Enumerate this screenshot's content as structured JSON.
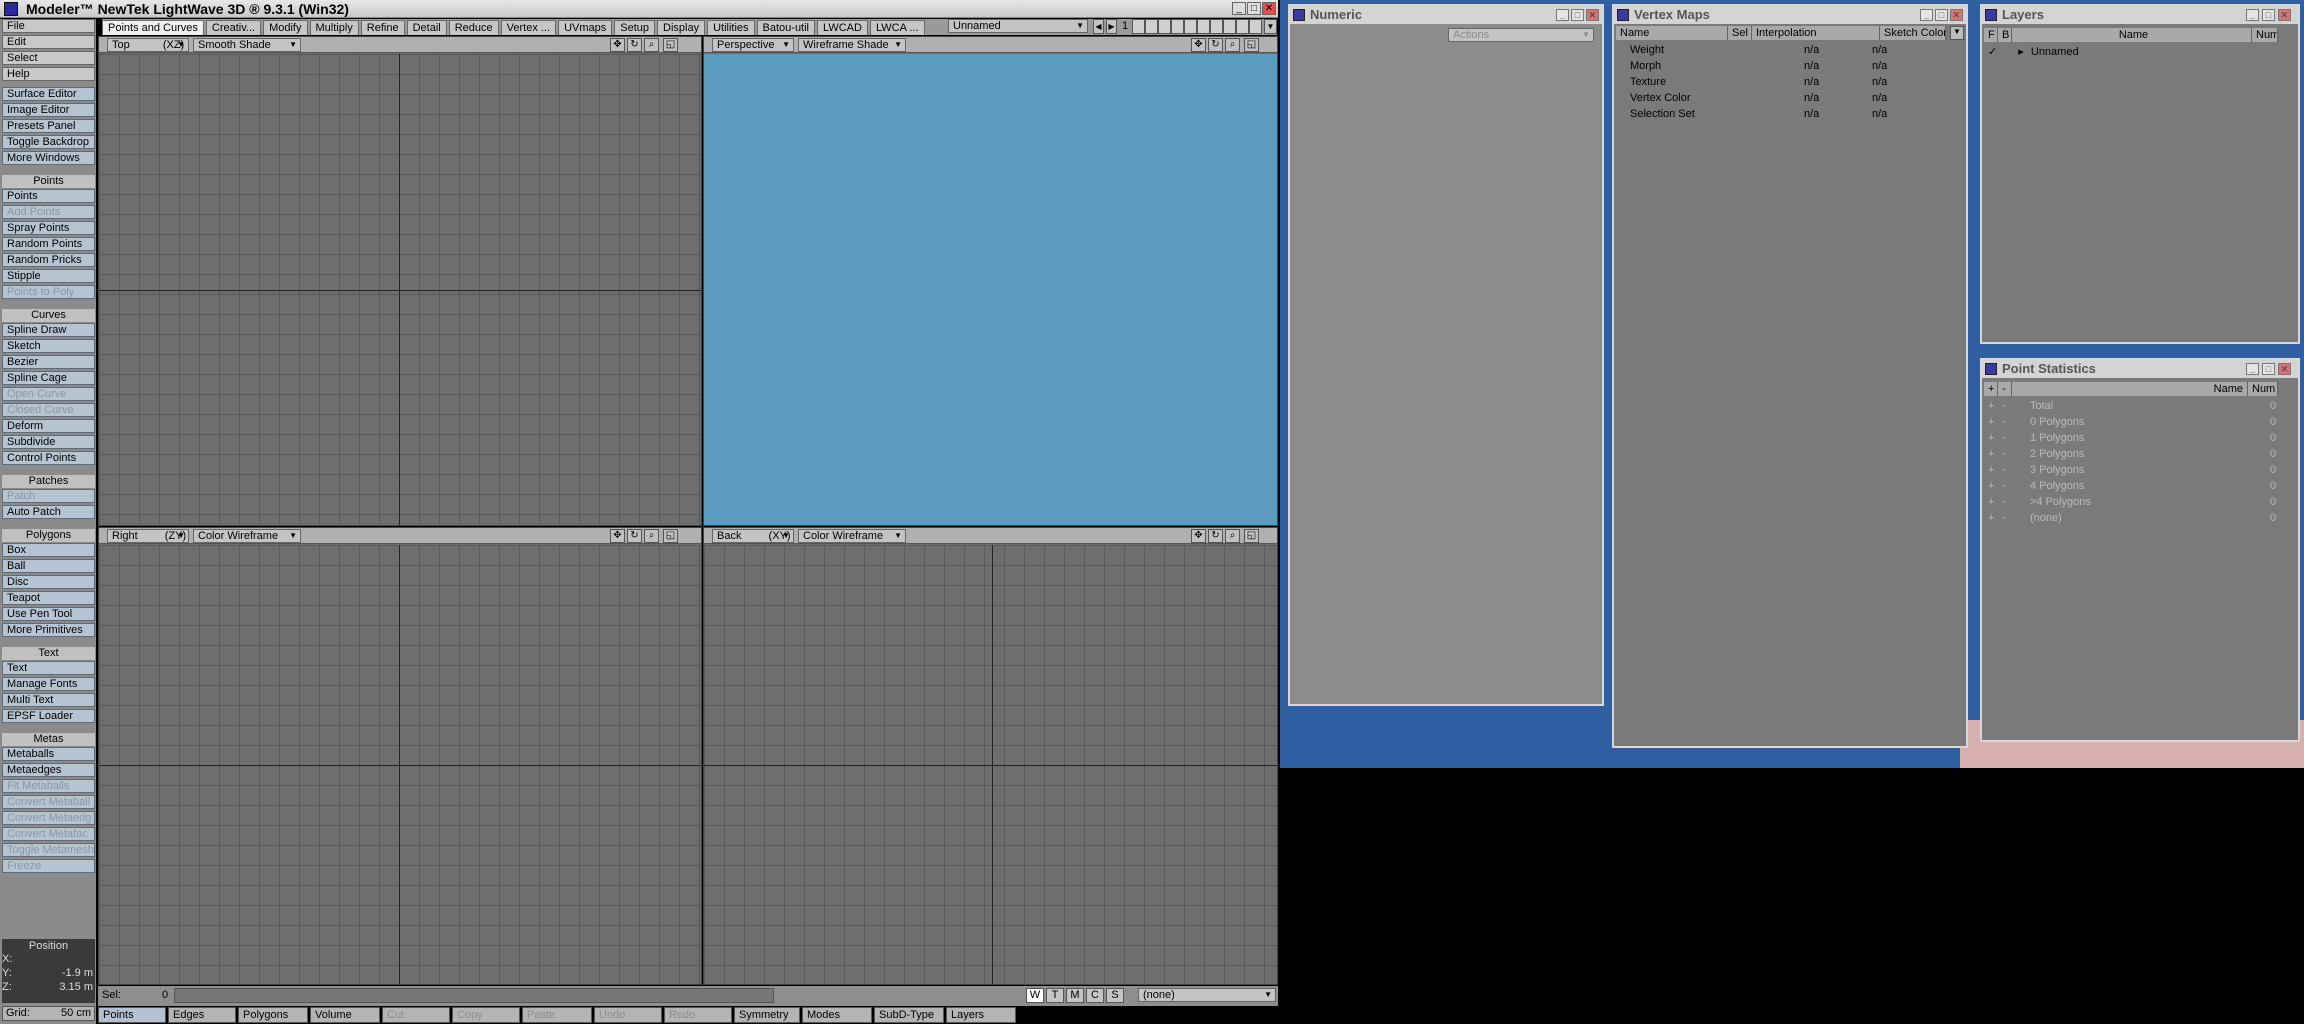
{
  "app": {
    "title": "Modeler™ NewTek LightWave 3D ® 9.3.1 (Win32)"
  },
  "tabs": [
    "Points and Curves",
    "Creativ...",
    "Modify",
    "Multiply",
    "Refine",
    "Reduce",
    "Detail",
    "Reduce",
    "Vertex ...",
    "UVmaps",
    "Setup",
    "Display",
    "Utilities",
    "Batou-util",
    "LWCAD",
    "LWCA ..."
  ],
  "object_dropdown": "Unnamed",
  "layer_num": "1",
  "sidebar": {
    "menus": [
      "File",
      "Edit",
      "Select",
      "Help"
    ],
    "windows": [
      "Surface Editor",
      "Image Editor",
      "Presets Panel",
      "Toggle Backdrop",
      "More Windows"
    ],
    "groups": [
      {
        "label": "Points",
        "items": [
          "Points",
          "Add Points",
          "Spray Points",
          "Random Points",
          "Random Pricks",
          "Stipple",
          "Points to Poly"
        ]
      },
      {
        "label": "Curves",
        "items": [
          "Spline Draw",
          "Sketch",
          "Bezier",
          "Spline Cage",
          "Open Curve",
          "Closed Curve",
          "Deform",
          "Subdivide",
          "Control Points"
        ]
      },
      {
        "label": "Patches",
        "items": [
          "Patch",
          "Auto Patch"
        ]
      },
      {
        "label": "Polygons",
        "items": [
          "Box",
          "Ball",
          "Disc",
          "Teapot",
          "Use Pen Tool",
          "More Primitives"
        ]
      },
      {
        "label": "Text",
        "items": [
          "Text",
          "Manage Fonts",
          "Multi Text",
          "EPSF Loader"
        ]
      },
      {
        "label": "Metas",
        "items": [
          "Metaballs",
          "Metaedges",
          "Fit Metaballs",
          "Convert Metaball",
          "Convert Metaedg",
          "Convert Metafac",
          "Toggle Metamesh",
          "Freeze"
        ]
      }
    ],
    "position": {
      "label": "Position",
      "x_label": "X:",
      "x": "",
      "y_label": "Y:",
      "y": "-1.9 m",
      "z_label": "Z:",
      "z": "3.15 m"
    },
    "grid_label": "Grid:",
    "grid_value": "50 cm"
  },
  "viewports": [
    {
      "view": "Top",
      "axes": "(XZ)",
      "mode": "Smooth Shade"
    },
    {
      "view": "Perspective",
      "axes": "",
      "mode": "Wireframe Shade"
    },
    {
      "view": "Right",
      "axes": "(ZY)",
      "mode": "Color Wireframe"
    },
    {
      "view": "Back",
      "axes": "(XY)",
      "mode": "Color Wireframe"
    }
  ],
  "bottom": {
    "sel_label": "Sel:",
    "sel_value": "0",
    "modes": [
      "W",
      "T",
      "M",
      "C",
      "S"
    ],
    "surface": "(none)",
    "buttons": [
      "Points",
      "Edges",
      "Polygons",
      "Volume",
      "Cut",
      "Copy",
      "Paste",
      "Undo",
      "Redo",
      "Symmetry",
      "Modes",
      "SubD-Type",
      "Layers"
    ]
  },
  "numeric": {
    "title": "Numeric",
    "actions": "Actions"
  },
  "vmaps": {
    "title": "Vertex Maps",
    "cols": [
      "Name",
      "Sel",
      "Interpolation",
      "Sketch Color"
    ],
    "rows": [
      [
        "Weight",
        "n/a",
        "n/a"
      ],
      [
        "Morph",
        "n/a",
        "n/a"
      ],
      [
        "Texture",
        "n/a",
        "n/a"
      ],
      [
        "Vertex Color",
        "n/a",
        "n/a"
      ],
      [
        "Selection Set",
        "n/a",
        "n/a"
      ]
    ]
  },
  "layers": {
    "title": "Layers",
    "cols": [
      "F",
      "B",
      "Name",
      "Num"
    ],
    "rows": [
      "Unnamed"
    ]
  },
  "stats": {
    "title": "Point Statistics",
    "cols": [
      "+",
      "-",
      "Name",
      "Num"
    ],
    "rows": [
      [
        "Total",
        "0"
      ],
      [
        "0 Polygons",
        "0"
      ],
      [
        "1 Polygons",
        "0"
      ],
      [
        "2 Polygons",
        "0"
      ],
      [
        "3 Polygons",
        "0"
      ],
      [
        "4 Polygons",
        "0"
      ],
      [
        ">4 Polygons",
        "0"
      ],
      [
        "(none)",
        "0"
      ]
    ]
  }
}
